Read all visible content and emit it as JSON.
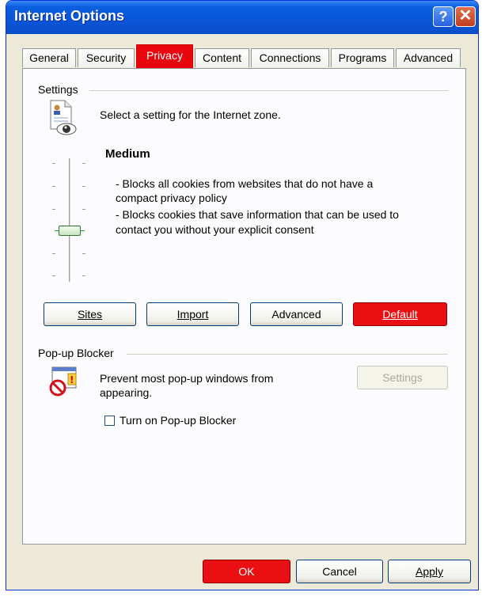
{
  "window": {
    "title": "Internet Options",
    "help_glyph": "?",
    "close_glyph": "✕"
  },
  "tabs": [
    {
      "label": "General",
      "active": false
    },
    {
      "label": "Security",
      "active": false
    },
    {
      "label": "Privacy",
      "active": true
    },
    {
      "label": "Content",
      "active": false
    },
    {
      "label": "Connections",
      "active": false
    },
    {
      "label": "Programs",
      "active": false
    },
    {
      "label": "Advanced",
      "active": false
    }
  ],
  "settings": {
    "group_label": "Settings",
    "zone_text": "Select a setting for the Internet zone.",
    "level_title": "Medium",
    "desc_line1": "- Blocks all cookies from websites that do not have a",
    "desc_line2": "compact privacy policy",
    "desc_line3": "- Blocks cookies that save information that can be used to",
    "desc_line4": "contact you without your explicit consent",
    "slider_level": "Medium",
    "buttons": {
      "sites": "Sites",
      "import": "Import",
      "advanced": "Advanced",
      "default": "Default"
    }
  },
  "popup": {
    "group_label": "Pop-up Blocker",
    "text_line1": "Prevent most pop-up windows from",
    "text_line2": "appearing.",
    "settings_button": "Settings",
    "checkbox_label": "Turn on Pop-up Blocker",
    "checkbox_checked": false
  },
  "footer": {
    "ok": "OK",
    "cancel": "Cancel",
    "apply": "Apply"
  },
  "colors": {
    "accent_red": "#e8050e",
    "title_blue": "#0a55d8"
  },
  "icons": [
    "help-icon",
    "close-icon",
    "privacy-document-eye-icon",
    "popup-blocked-icon"
  ]
}
